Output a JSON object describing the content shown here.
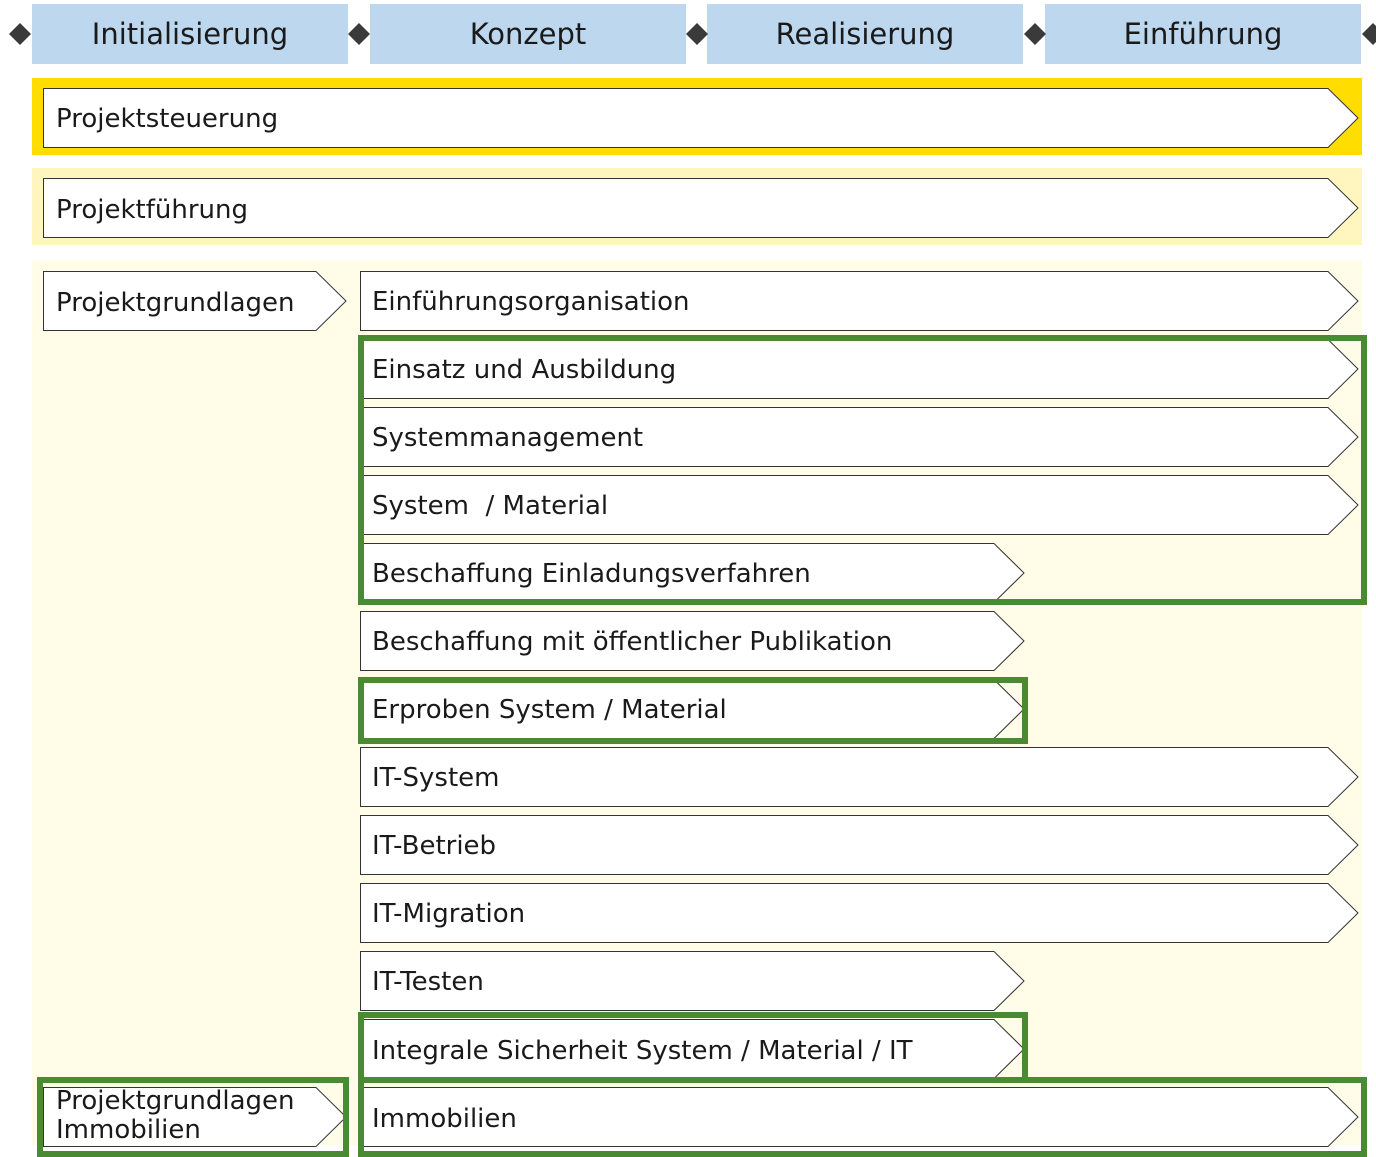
{
  "phases": [
    "Initialisierung",
    "Konzept",
    "Realisierung",
    "Einführung"
  ],
  "colors": {
    "phase_fill": "#bdd7ee",
    "steering_band": "#ffdd00",
    "guidance_band": "#fff6bf",
    "module_area": "#fffde7",
    "highlight": "#4a8a32",
    "milestone": "#3a3a3a"
  },
  "bands": {
    "steering": "Projektsteuerung",
    "guidance": "Projektführung"
  },
  "basis": {
    "general": "Projektgrundlagen",
    "immo_line1": "Projektgrundlagen",
    "immo_line2": "Immobilien"
  },
  "modules": [
    "Einführungsorganisation",
    "Einsatz und Ausbildung",
    "Systemmanagement",
    "System  / Material",
    "Beschaffung Einladungsverfahren",
    "Beschaffung mit öffentlicher Publikation",
    "Erproben System / Material",
    "IT-System",
    "IT-Betrieb",
    "IT-Migration",
    "IT-Testen",
    "Integrale Sicherheit System / Material / IT",
    "Immobilien"
  ]
}
